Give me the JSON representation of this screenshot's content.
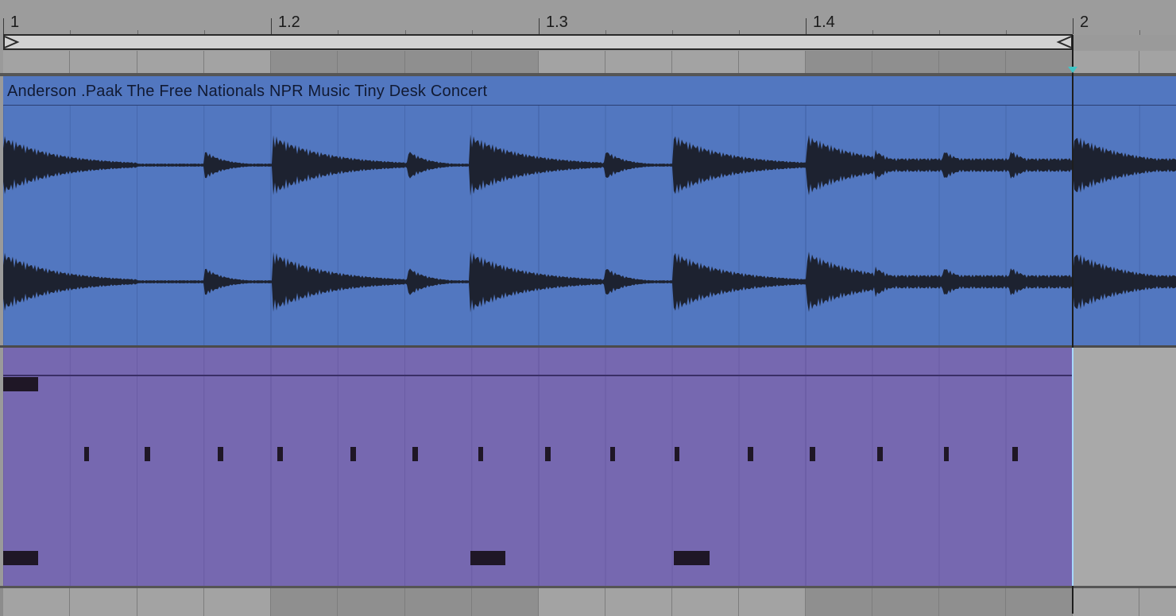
{
  "ruler": {
    "bars": [
      "1",
      "1.2",
      "1.3",
      "1.4",
      "2"
    ]
  },
  "audio_clip": {
    "name": "Anderson .Paak  The Free Nationals NPR Music Tiny Desk Concert",
    "color": "#5277c0"
  },
  "midi_clip": {
    "color": "#7668b0",
    "note_color": "#1f1726"
  },
  "colors": {
    "loop_brace": "#d2d2d2",
    "playhead_marker": "#3fc5c5",
    "background": "#9a9a9a"
  }
}
